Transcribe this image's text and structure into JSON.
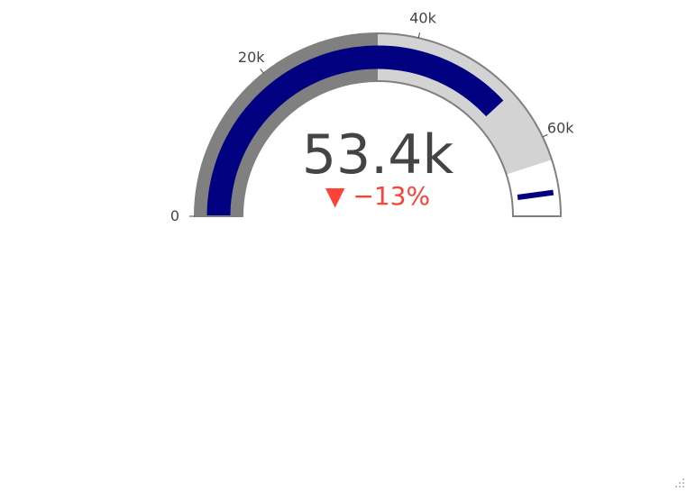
{
  "chart_data": {
    "type": "gauge",
    "value": 53400,
    "value_text": "53.4k",
    "delta": {
      "text": "−13%",
      "symbol": "▼",
      "color": "#ff4136"
    },
    "axis": {
      "range": [
        0,
        70000
      ],
      "ticks": [
        {
          "value": 0,
          "label": "0"
        },
        {
          "value": 20000,
          "label": "20k"
        },
        {
          "value": 40000,
          "label": "40k"
        },
        {
          "value": 60000,
          "label": "60k"
        }
      ]
    },
    "bar": {
      "value": 53400,
      "color": "#000080"
    },
    "steps": [
      {
        "range": [
          0,
          35000
        ],
        "color": "#808080"
      },
      {
        "range": [
          35000,
          63000
        ],
        "color": "#d3d3d3"
      }
    ],
    "threshold": {
      "value": 67000,
      "color": "#000080"
    },
    "border_color": "#808080"
  }
}
